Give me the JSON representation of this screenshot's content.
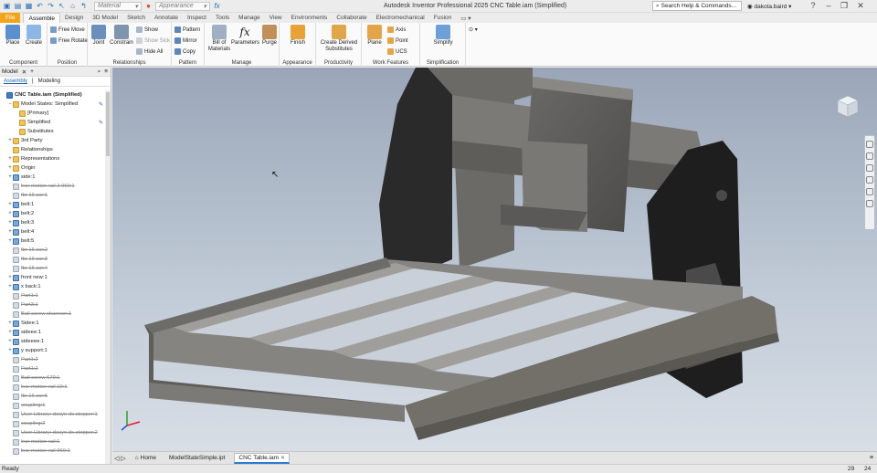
{
  "app": {
    "title": "Autodesk Inventor Professional 2025   CNC Table.iam (Simplified)",
    "help_search_placeholder": "Search Help & Commands...",
    "user": "dakota.baird"
  },
  "quick_access": {
    "material_combo": "Material",
    "appearance_combo": "Appearance",
    "icons": [
      "new-icon",
      "open-icon",
      "save-icon",
      "undo-icon",
      "redo-icon",
      "select-icon",
      "home-icon",
      "return-icon",
      "parameters-icon"
    ]
  },
  "tabs": [
    "File",
    "Assemble",
    "Design",
    "3D Model",
    "Sketch",
    "Annotate",
    "Inspect",
    "Tools",
    "Manage",
    "View",
    "Environments",
    "Collaborate",
    "Electromechanical",
    "Fusion"
  ],
  "active_tab": "Assemble",
  "ribbon": {
    "component": {
      "label": "Component",
      "place": "Place",
      "create": "Create"
    },
    "position": {
      "label": "Position",
      "free_move": "Free Move",
      "free_rotate": "Free Rotate"
    },
    "relationships": {
      "label": "Relationships",
      "joint": "Joint",
      "constrain": "Constrain",
      "show": "Show",
      "show_sick": "Show Sick",
      "hide_all": "Hide All"
    },
    "pattern": {
      "label": "Pattern",
      "pattern": "Pattern",
      "mirror": "Mirror",
      "copy": "Copy"
    },
    "manage": {
      "label": "Manage",
      "bom": "Bill of\nMaterials",
      "parameters": "Parameters",
      "purge": "Purge"
    },
    "appearance": {
      "label": "Appearance",
      "finish": "Finish"
    },
    "productivity": {
      "label": "Productivity",
      "create_derived": "Create Derived\nSubstitutes"
    },
    "work_features": {
      "label": "Work Features",
      "plane": "Plane",
      "axis": "Axis",
      "point": "Point",
      "ucs": "UCS"
    },
    "simplification": {
      "label": "Simplification",
      "simplify": "Simplify"
    }
  },
  "browser": {
    "title": "Model",
    "tabs": [
      "Assembly",
      "Modeling"
    ],
    "active_tab": "Assembly",
    "tree": [
      {
        "label": "CNC Table.iam (Simplified)",
        "kind": "asm",
        "level": 0,
        "bold": true
      },
      {
        "label": "Model States: Simplified",
        "kind": "folder",
        "level": 1,
        "exp": "−",
        "edit": true
      },
      {
        "label": "[Primary]",
        "kind": "folder",
        "level": 2
      },
      {
        "label": "Simplified",
        "kind": "folder",
        "level": 2,
        "edit": true
      },
      {
        "label": "Substitutes",
        "kind": "folder",
        "level": 2
      },
      {
        "label": "3rd Party",
        "kind": "folder",
        "level": 1,
        "exp": "+"
      },
      {
        "label": "Relationships",
        "kind": "folder",
        "level": 1
      },
      {
        "label": "Representations",
        "kind": "folder",
        "level": 1,
        "exp": "+"
      },
      {
        "label": "Origin",
        "kind": "folder",
        "level": 1,
        "exp": "+"
      },
      {
        "label": "side:1",
        "kind": "part",
        "level": 1,
        "exp": "+"
      },
      {
        "label": "lncr motion rail 2 960:1",
        "kind": "part",
        "level": 1,
        "sup": true
      },
      {
        "label": "fbr 16 ssr:1",
        "kind": "part",
        "level": 1,
        "sup": true
      },
      {
        "label": "belt:1",
        "kind": "part",
        "level": 1,
        "exp": "+"
      },
      {
        "label": "belt:2",
        "kind": "part",
        "level": 1,
        "exp": "+"
      },
      {
        "label": "belt:3",
        "kind": "part",
        "level": 1,
        "exp": "+"
      },
      {
        "label": "belt:4",
        "kind": "part",
        "level": 1,
        "exp": "+"
      },
      {
        "label": "belt:5",
        "kind": "part",
        "level": 1,
        "exp": "+"
      },
      {
        "label": "fbr 16 ssr:2",
        "kind": "part",
        "level": 1,
        "sup": true
      },
      {
        "label": "fbr 16 ssr:3",
        "kind": "part",
        "level": 1,
        "sup": true
      },
      {
        "label": "fbr 16 ssr:4",
        "kind": "part",
        "level": 1,
        "sup": true
      },
      {
        "label": "front new:1",
        "kind": "part",
        "level": 1,
        "exp": "+"
      },
      {
        "label": "x back:1",
        "kind": "part",
        "level": 1,
        "exp": "+"
      },
      {
        "label": "Part1:1",
        "kind": "part",
        "level": 1,
        "sup": true
      },
      {
        "label": "Part3:1",
        "kind": "part",
        "level": 1,
        "sup": true
      },
      {
        "label": "Ball screw shannon:1",
        "kind": "part",
        "level": 1,
        "sup": true
      },
      {
        "label": "Sidee:1",
        "kind": "part",
        "level": 1,
        "exp": "+"
      },
      {
        "label": "sideee:1",
        "kind": "part",
        "level": 1,
        "exp": "+"
      },
      {
        "label": "sideeee:1",
        "kind": "part",
        "level": 1,
        "exp": "+"
      },
      {
        "label": "y support:1",
        "kind": "part",
        "level": 1,
        "exp": "+"
      },
      {
        "label": "Part1:2",
        "kind": "part",
        "level": 1,
        "sup": true
      },
      {
        "label": "Part1:2",
        "kind": "part",
        "level": 1,
        "sup": true
      },
      {
        "label": "Ball screw 670:1",
        "kind": "part",
        "level": 1,
        "sup": true
      },
      {
        "label": "lncr motion rail 10:1",
        "kind": "part",
        "level": 1,
        "sup": true
      },
      {
        "label": "fbr 16 ssr:5",
        "kind": "part",
        "level": 1,
        "sup": true
      },
      {
        "label": "coupling:1",
        "kind": "part",
        "level": 1,
        "sup": true
      },
      {
        "label": "User Library: dosyn dc stepper:1",
        "kind": "part",
        "level": 1,
        "sup": true
      },
      {
        "label": "coupling:2",
        "kind": "part",
        "level": 1,
        "sup": true
      },
      {
        "label": "User Library: dosyn dc stepper:2",
        "kind": "part",
        "level": 1,
        "sup": true
      },
      {
        "label": "lncr motion rail:1",
        "kind": "part",
        "level": 1,
        "sup": true
      },
      {
        "label": "lncr motion rail 960:1",
        "kind": "part",
        "level": 1,
        "sup": true
      }
    ]
  },
  "doc_tabs": [
    "Home",
    "ModelStateSimple.ipt",
    "CNC Table.iam"
  ],
  "active_doc": "CNC Table.iam",
  "status": {
    "text": "Ready",
    "num1": "29",
    "num2": "24"
  },
  "colors": {
    "file_tab": "#f4a41b",
    "accent": "#2f7ad6",
    "plate": "#5b5a58"
  }
}
